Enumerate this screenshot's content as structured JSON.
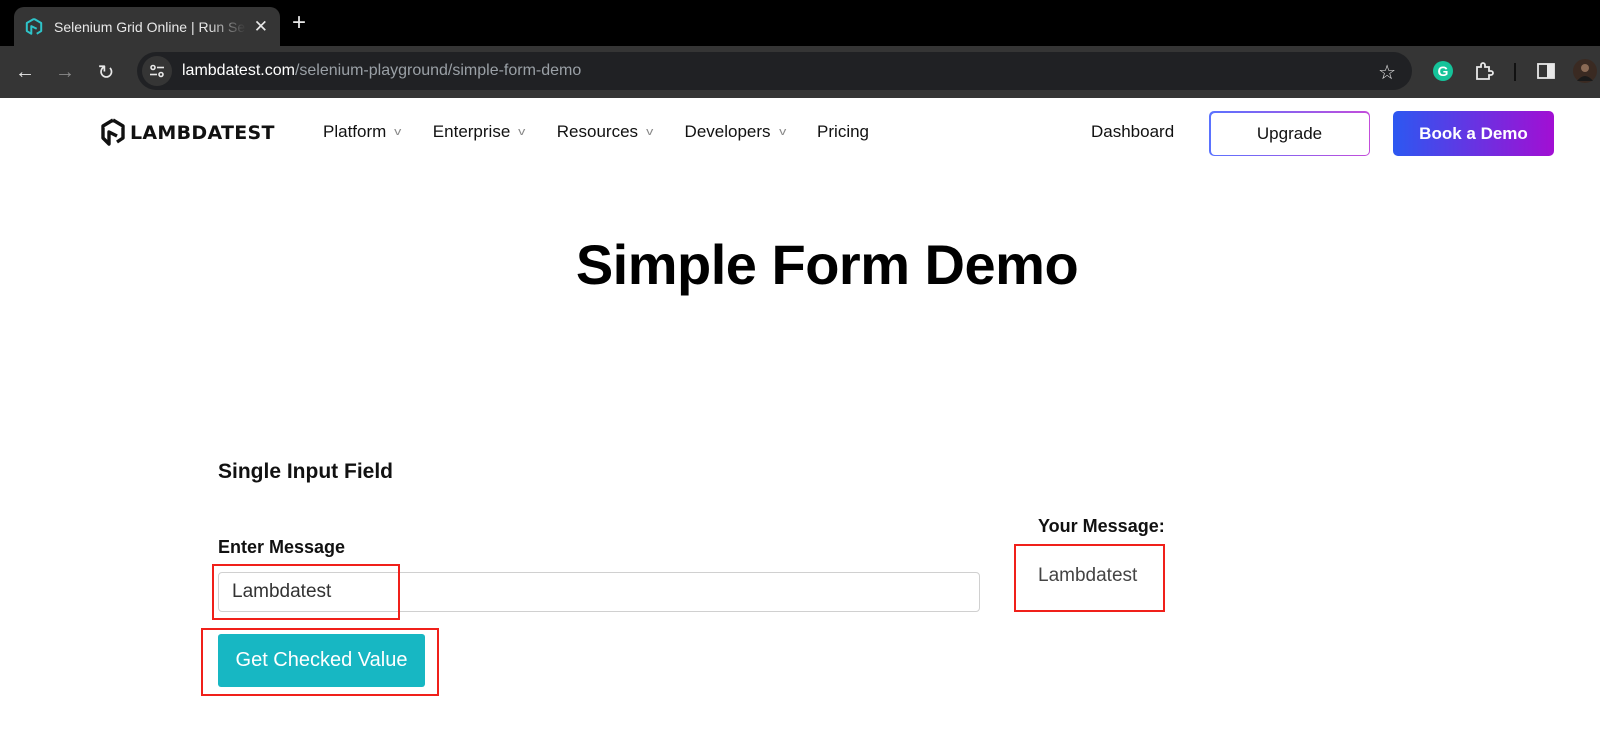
{
  "browser": {
    "tab_title": "Selenium Grid Online | Run Selenium Test",
    "url_domain": "lambdatest.com",
    "url_path": "/selenium-playground/simple-form-demo"
  },
  "header": {
    "logo_text": "LAMBDATEST",
    "nav": [
      {
        "label": "Platform",
        "has_dropdown": true
      },
      {
        "label": "Enterprise",
        "has_dropdown": true
      },
      {
        "label": "Resources",
        "has_dropdown": true
      },
      {
        "label": "Developers",
        "has_dropdown": true
      },
      {
        "label": "Pricing",
        "has_dropdown": false
      }
    ],
    "dashboard_label": "Dashboard",
    "upgrade_label": "Upgrade",
    "book_demo_label": "Book a Demo"
  },
  "page": {
    "title": "Simple Form Demo",
    "section_title": "Single Input Field",
    "input_label": "Enter Message",
    "input_value": "Lambdatest",
    "button_label": "Get Checked Value",
    "output_label": "Your Message:",
    "output_value": "Lambdatest"
  },
  "colors": {
    "button_bg": "#17b7c3",
    "highlight": "#f0201a",
    "book_demo_gradient": [
      "#2c58f1",
      "#a20fd3"
    ]
  }
}
